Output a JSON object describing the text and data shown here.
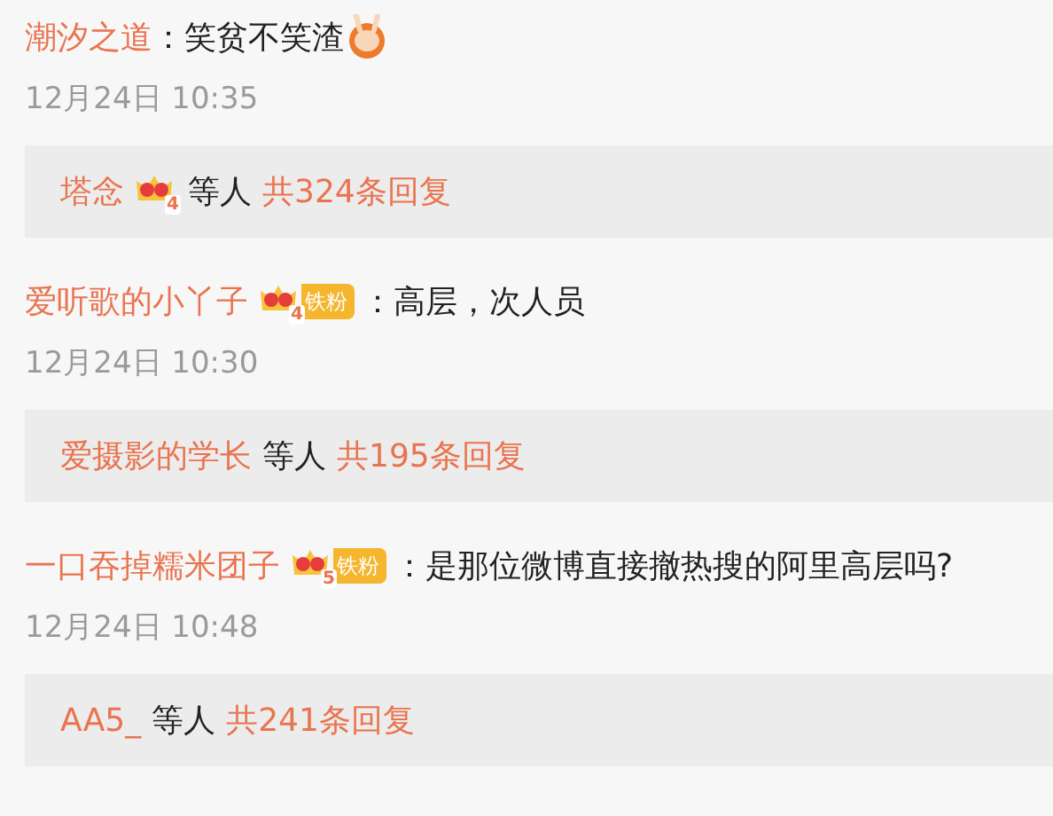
{
  "comments": [
    {
      "user": "潮汐之道",
      "separator": "：",
      "text": "笑贫不笑渣",
      "emoji": true,
      "time": "12月24日 10:35",
      "reply_summary": {
        "user": "塔念",
        "user_badge": {
          "level": "4"
        },
        "middle": "等人",
        "count": "共324条回复"
      }
    },
    {
      "user": "爱听歌的小丫子",
      "badge": {
        "level": "4",
        "label": "铁粉"
      },
      "separator": "：",
      "text": "高层，次人员",
      "emoji": false,
      "time": "12月24日 10:30",
      "reply_summary": {
        "user": "爱摄影的学长",
        "middle": "等人",
        "count": "共195条回复"
      }
    },
    {
      "user": "一口吞掉糯米团子",
      "badge": {
        "level": "5",
        "label": "铁粉"
      },
      "separator": "：",
      "text": "是那位微博直接撤热搜的阿里高层吗?",
      "emoji": false,
      "time": "12月24日 10:48",
      "reply_summary": {
        "user": "AA5_",
        "middle": "等人",
        "count": "共241条回复"
      }
    }
  ]
}
